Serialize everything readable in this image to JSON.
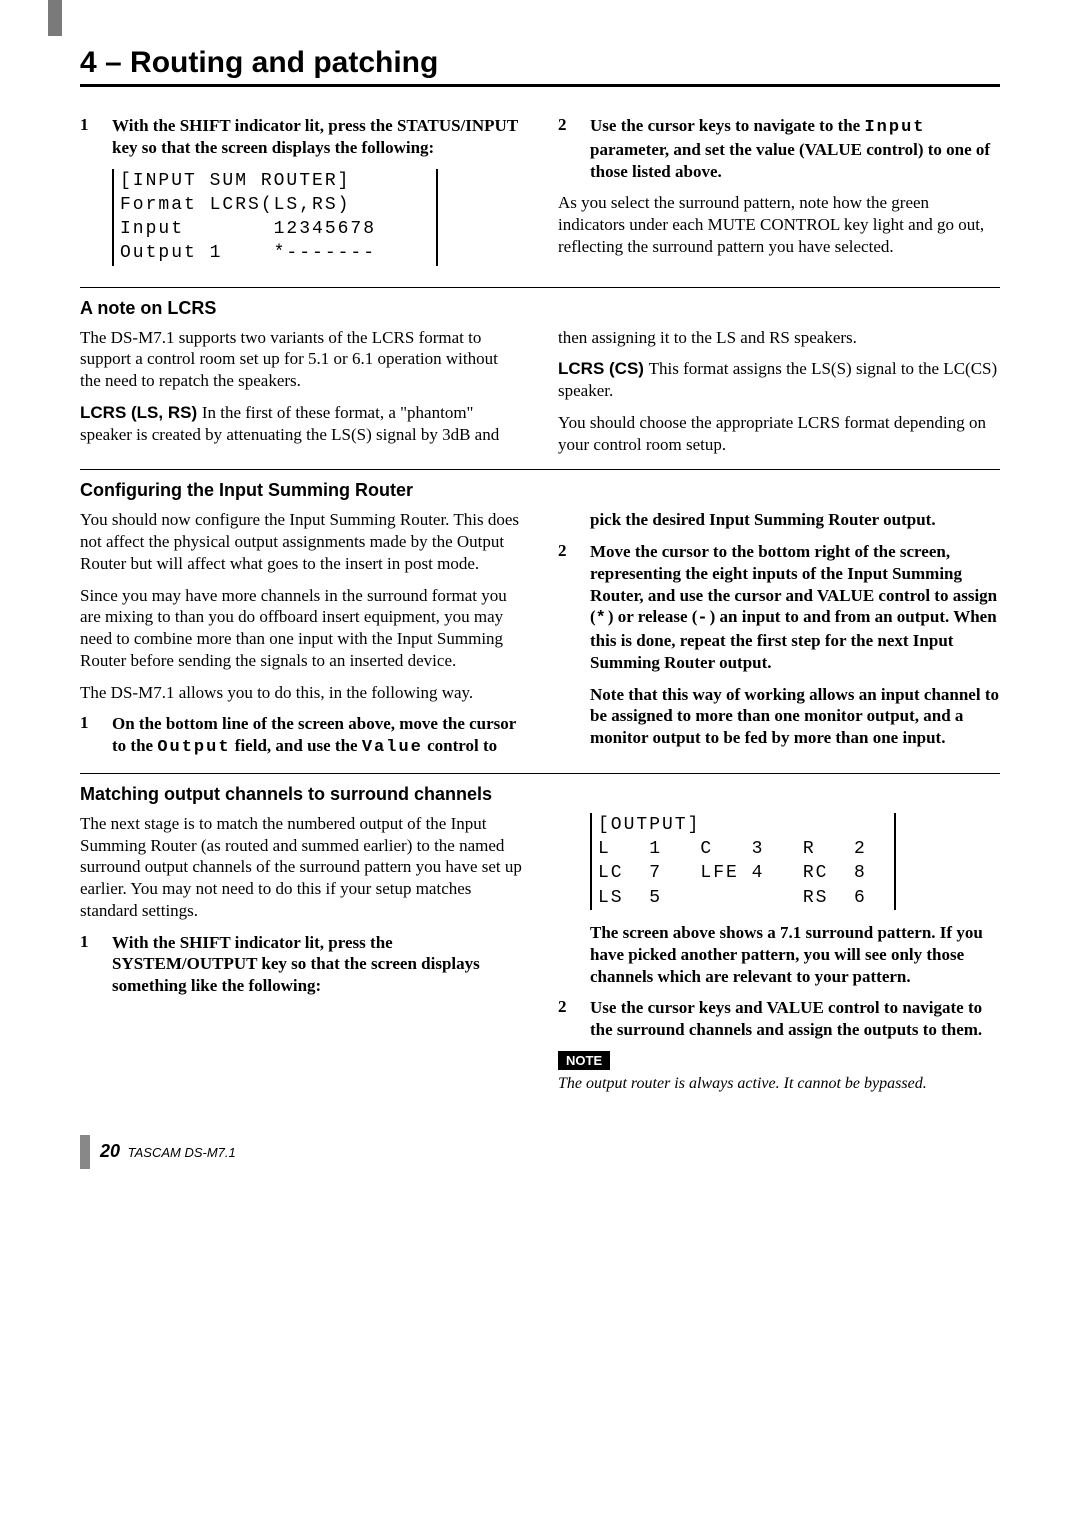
{
  "header": {
    "title": "4 – Routing and patching"
  },
  "sec1": {
    "step1_num": "1",
    "step1": "With the SHIFT indicator lit, press the STATUS/INPUT key so that the screen displays the following:",
    "lcd": "[INPUT SUM ROUTER]\nFormat LCRS(LS,RS)\nInput       12345678\nOutput 1    *-------",
    "step2_num": "2",
    "step2_a": "Use the cursor keys to navigate to the ",
    "step2_mono": "Input",
    "step2_b": " parameter, and set the value (VALUE control) to one of those listed above.",
    "para": "As you select the surround pattern, note how the green indicators under each MUTE CONTROL key light and go out, reflecting the surround pattern you have selected."
  },
  "lcrs": {
    "head": "A note on LCRS",
    "p1": "The DS-M7.1 supports two variants of the LCRS format to support a control room set up for 5.1 or 6.1 operation without the need to repatch the speakers.",
    "lsrs_label": "LCRS (LS, RS) ",
    "lsrs_text": "In the first of these format, a \"phantom\" speaker is created by attenuating the LS(S) signal by 3dB and then assigning it to the LS and RS speakers.",
    "cs_label": "LCRS (CS) ",
    "cs_text": "This format assigns the LS(S) signal to the LC(CS) speaker.",
    "p4": "You should choose the appropriate LCRS format depending on your control room setup."
  },
  "cfg": {
    "head": "Configuring the Input Summing Router",
    "p1": "You should now configure the Input Summing Router. This does not affect the physical output assignments made by the Output Router but will affect what goes to the insert in post mode.",
    "p2": "Since you may have more channels in the surround format you are mixing to than you do offboard insert equipment, you may need to combine more than one input with the Input Summing Router before sending the signals to an inserted device.",
    "p3": "The DS-M7.1 allows you to do this, in the following way.",
    "s1_num": "1",
    "s1_a": "On the bottom line of the screen above, move the cursor to the ",
    "s1_mono1": "Output",
    "s1_b": " field, and use the ",
    "s1_mono2": "Value",
    "s1_c": " control to pick the desired Input Summing Router output.",
    "s2_num": "2",
    "s2_a": "Move the cursor to the bottom right of the screen, representing the eight inputs of the Input Summing Router, and use the cursor and VALUE control to assign (",
    "s2_star": "*",
    "s2_b": ") or release (",
    "s2_dash": "-",
    "s2_c": ") an input to and from an output. When this is done, repeat the first step for the next Input Summing Router output.",
    "s2_note": "Note that this way of working allows an input channel to be assigned to more than one monitor output, and a monitor output to be fed by more than one input."
  },
  "match": {
    "head": "Matching output channels to surround channels",
    "p1": "The next stage is to match the numbered output of the Input Summing Router (as routed and summed earlier) to the named surround output channels of the surround pattern you have set up earlier. You may not need to do this if your setup matches standard settings.",
    "s1_num": "1",
    "s1": "With the SHIFT indicator lit, press the SYSTEM/OUTPUT key so that the screen displays something like the following:",
    "lcd": "[OUTPUT]\nL   1   C   3   R   2\nLC  7   LFE 4   RC  8\nLS  5           RS  6",
    "s1b": "The screen above shows a 7.1 surround pattern. If you have picked another pattern, you will see only those channels which are relevant to your pattern.",
    "s2_num": "2",
    "s2": "Use the cursor keys and VALUE control to navigate to the surround channels and assign the outputs to them.",
    "note_label": "NOTE",
    "note": "The output router is always active. It cannot be bypassed."
  },
  "footer": {
    "page": "20",
    "model": " TASCAM DS-M7.1"
  }
}
